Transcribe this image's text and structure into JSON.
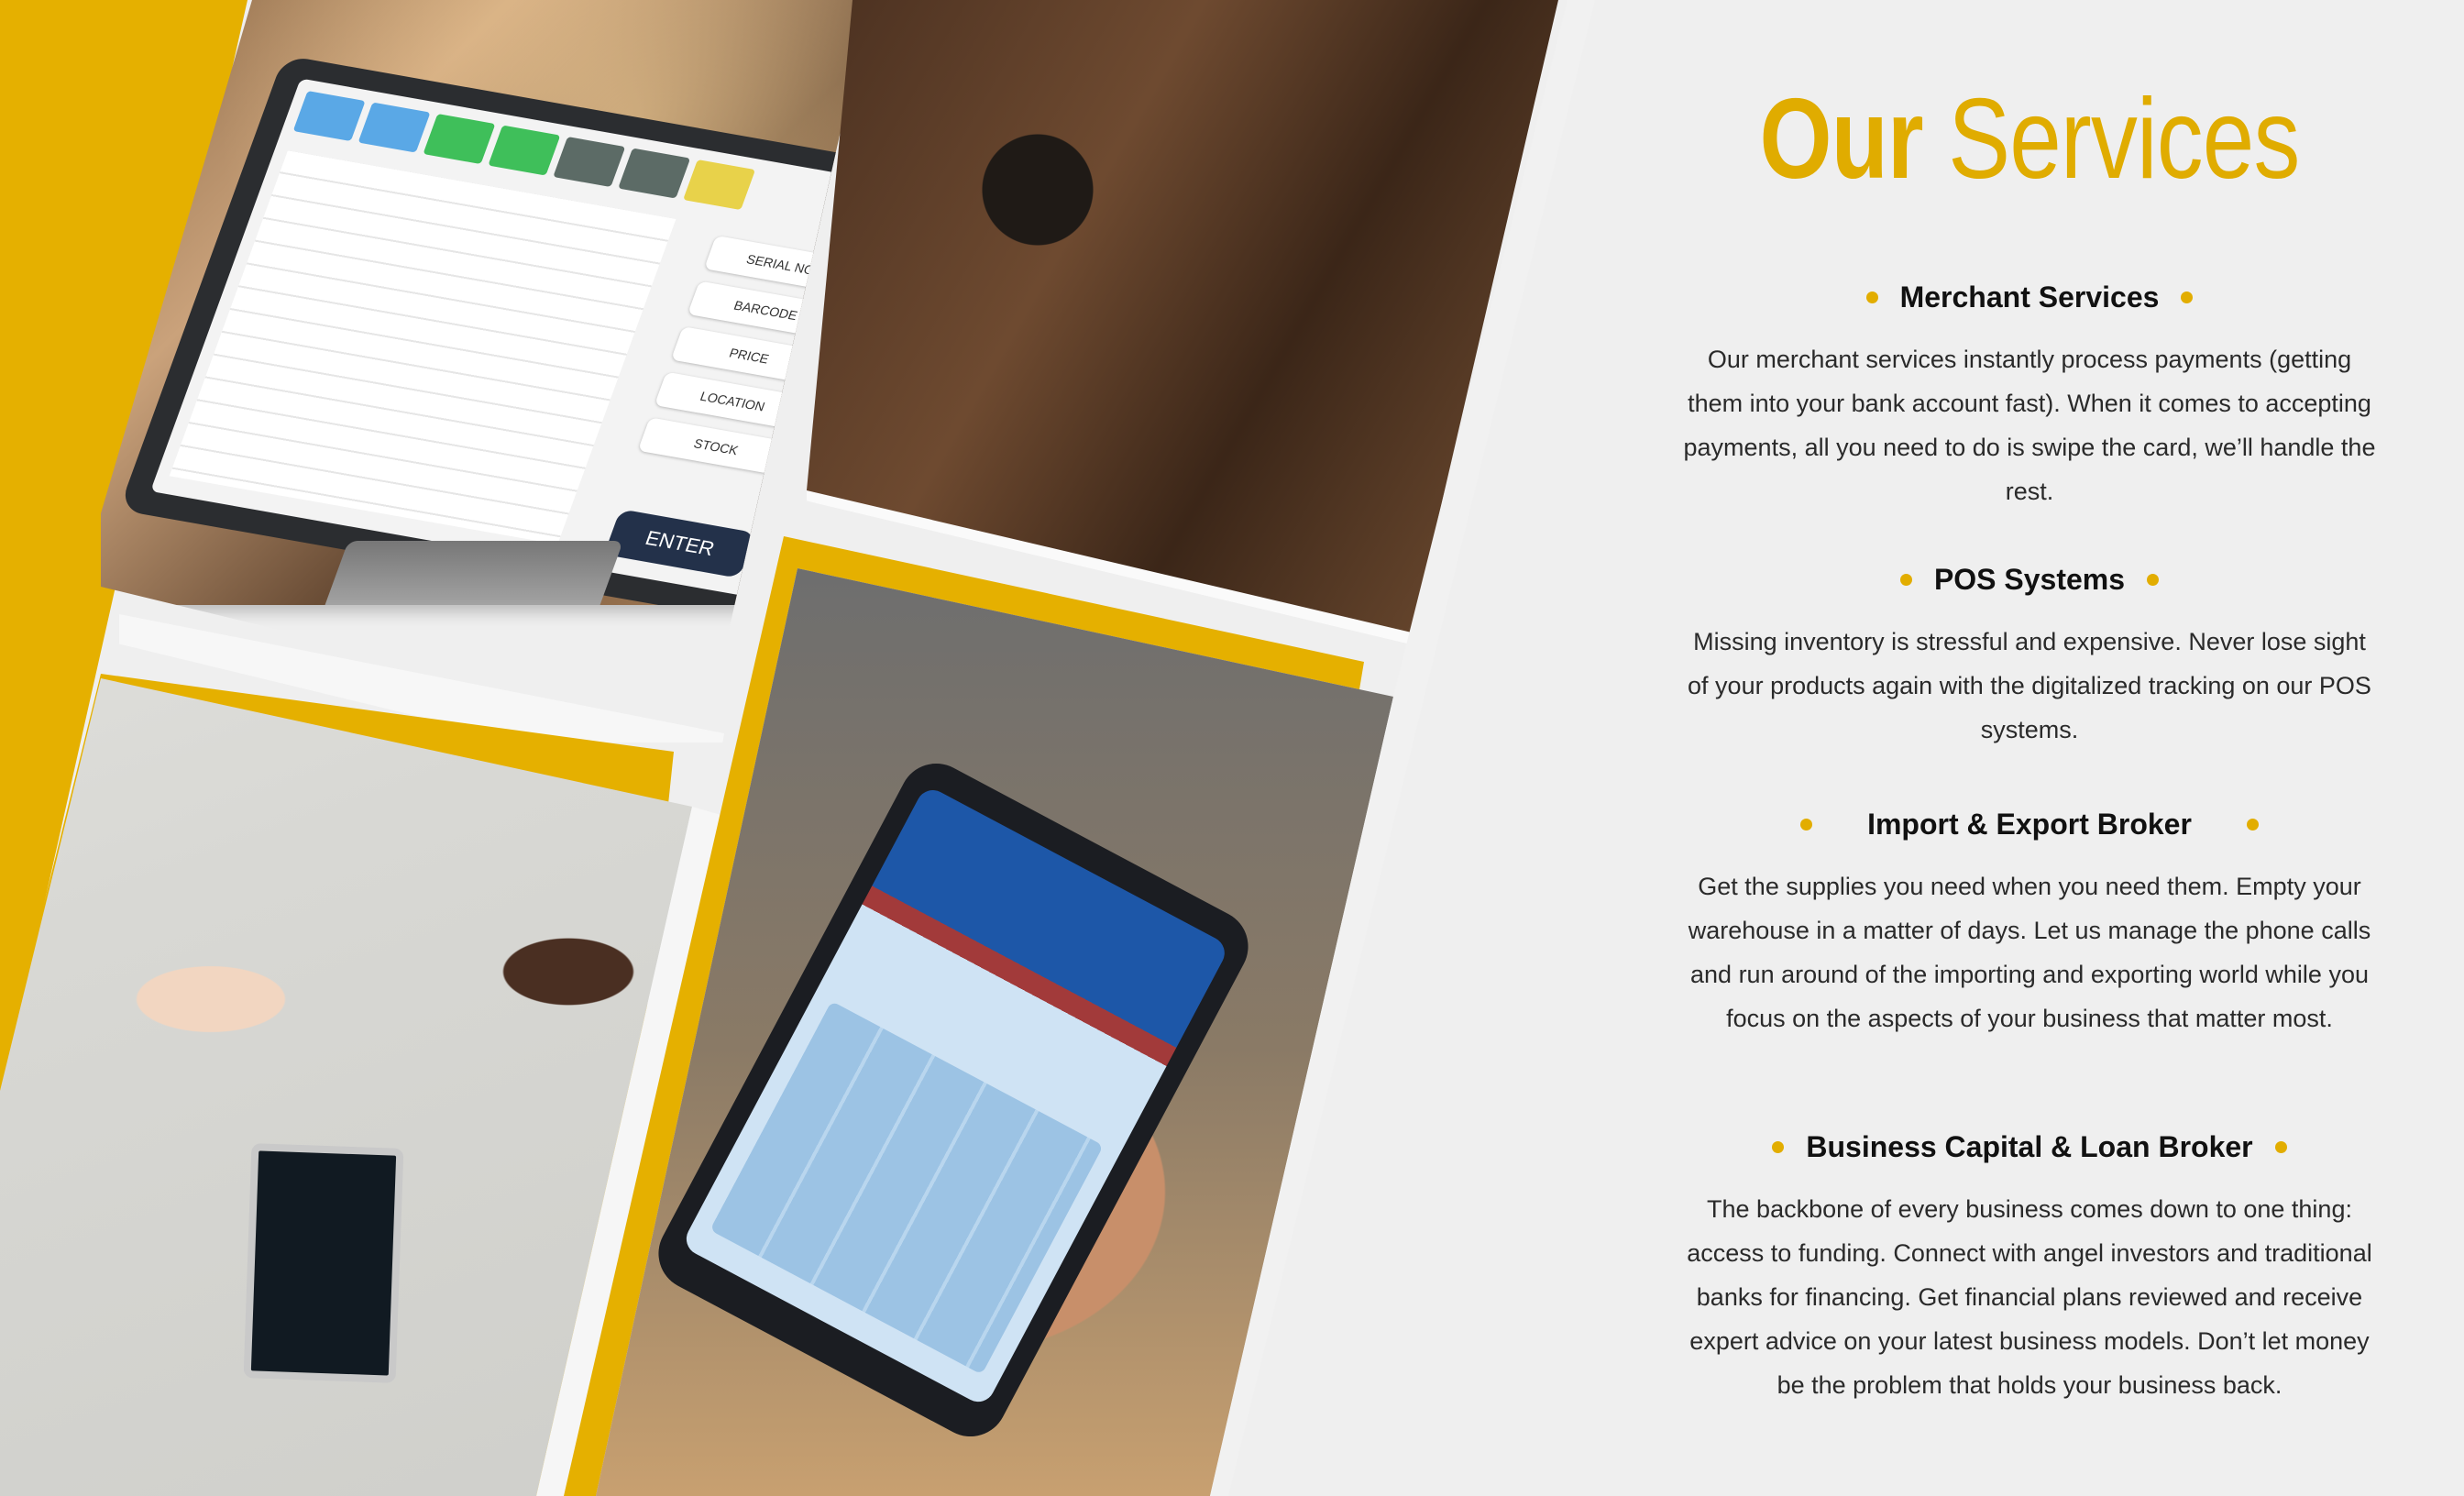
{
  "title": {
    "strong": "Our",
    "light": "Services"
  },
  "accent_color": "#e2ad00",
  "pos_terminal": {
    "buttons": [
      "SERIAL NO.",
      "BARCODE",
      "PRICE",
      "LOCATION",
      "STOCK"
    ],
    "enter": "ENTER"
  },
  "services": [
    {
      "heading": "Merchant Services",
      "body": "Our merchant services instantly process payments (getting them into your bank account fast). When it comes to accepting payments, all you need to do is swipe the card, we’ll handle the rest."
    },
    {
      "heading": "POS Systems",
      "body": "Missing inventory is stressful and expensive. Never lose sight of your products again with the digitalized tracking on our POS systems."
    },
    {
      "heading": "Import & Export Broker",
      "body": "Get the supplies you need when you need them. Empty your warehouse in a matter of days. Let us manage the phone calls and run around of the importing and exporting world while you focus on the aspects of your business that matter most."
    },
    {
      "heading": "Business Capital & Loan Broker",
      "body": "The backbone of every business comes down to one thing: access to funding. Connect with angel investors and traditional banks for financing. Get financial plans reviewed and receive expert advice on your latest business models. Don’t let money be the problem that holds your business back."
    }
  ]
}
